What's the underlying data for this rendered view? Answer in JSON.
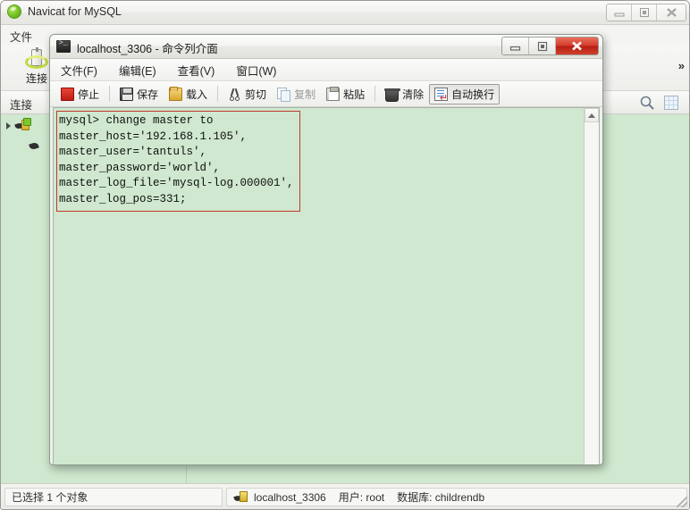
{
  "app_window": {
    "title": "Navicat for MySQL",
    "app_icon": "navicat-logo-icon",
    "menu": {
      "file": "文件"
    },
    "toolbar": {
      "connect_label": "连接",
      "connect_icon": "connection-plug-icon",
      "overflow_label": "»",
      "dropdown_icon": "chevron-down-icon"
    },
    "panel": {
      "title": "连接",
      "search_icon": "search-icon",
      "grid_icon": "grid-icon"
    },
    "window_buttons": {
      "minimize": "minimize-icon",
      "maximize": "maximize-icon",
      "close": "close-icon"
    },
    "status_bar": {
      "left": "已选择 1 个对象",
      "connection_icon": "server-connection-icon",
      "connection": "localhost_3306",
      "user": "用户: root",
      "database": "数据库: childrendb"
    }
  },
  "cmd_window": {
    "title": "localhost_3306 - 命令列介面",
    "icon": "console-icon",
    "window_buttons": {
      "minimize": "minimize-icon",
      "restore": "restore-icon",
      "close": "close-icon"
    },
    "menu": [
      {
        "label": "文件(F)",
        "name": "menu-file"
      },
      {
        "label": "编辑(E)",
        "name": "menu-edit"
      },
      {
        "label": "查看(V)",
        "name": "menu-view"
      },
      {
        "label": "窗口(W)",
        "name": "menu-window"
      }
    ],
    "toolbar": [
      {
        "label": "停止",
        "icon": "stop-icon",
        "state": "normal"
      },
      {
        "label": "保存",
        "icon": "save-icon",
        "state": "normal"
      },
      {
        "label": "载入",
        "icon": "load-folder-icon",
        "state": "normal"
      },
      {
        "label": "剪切",
        "icon": "cut-scissors-icon",
        "state": "normal"
      },
      {
        "label": "复制",
        "icon": "copy-icon",
        "state": "disabled"
      },
      {
        "label": "粘贴",
        "icon": "paste-clipboard-icon",
        "state": "normal"
      },
      {
        "label": "清除",
        "icon": "trash-clear-icon",
        "state": "normal"
      },
      {
        "label": "自动换行",
        "icon": "word-wrap-icon",
        "state": "pressed"
      }
    ],
    "console": {
      "background_color": "#cfe8cf",
      "highlight_border_color": "#c0392b",
      "text": "mysql> change master to\nmaster_host='192.168.1.105',\nmaster_user='tantuls',\nmaster_password='world',\nmaster_log_file='mysql-log.000001',\nmaster_log_pos=331;",
      "scrollbar": {
        "up_arrow": "scroll-up-icon",
        "down_arrow": "scroll-down-icon"
      }
    }
  }
}
